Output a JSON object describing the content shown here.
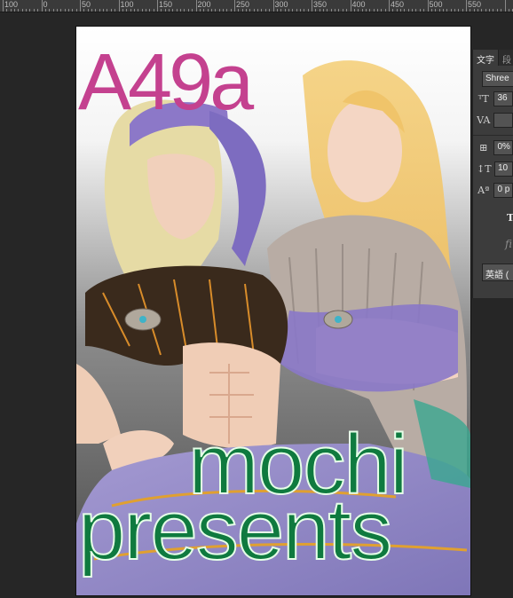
{
  "ruler": {
    "labels": [
      "100",
      "0",
      "50",
      "100",
      "150",
      "200",
      "250",
      "300",
      "350",
      "400",
      "450",
      "500",
      "550"
    ]
  },
  "document": {
    "title": "A49a",
    "line1": "mochi",
    "line2": "presents",
    "colors": {
      "title": "#c4418f",
      "text": "#0f7a3f",
      "hair_left": "#e6dba5",
      "hair_right": "#f0c46a",
      "turban": "#8c78c8",
      "skin": "#f2d2c0",
      "top_left": "#3a2a1c",
      "sweater": "#b8aca4",
      "pants": "#9a90c8"
    }
  },
  "panel": {
    "tabs": [
      "文字",
      "段"
    ],
    "font_family": "Shree",
    "font_size": "36",
    "tracking": "",
    "scale": "0%",
    "leading": "10",
    "baseline": "0 p",
    "style_label": "T",
    "ligature_label": "fi",
    "language": "英語 ("
  }
}
